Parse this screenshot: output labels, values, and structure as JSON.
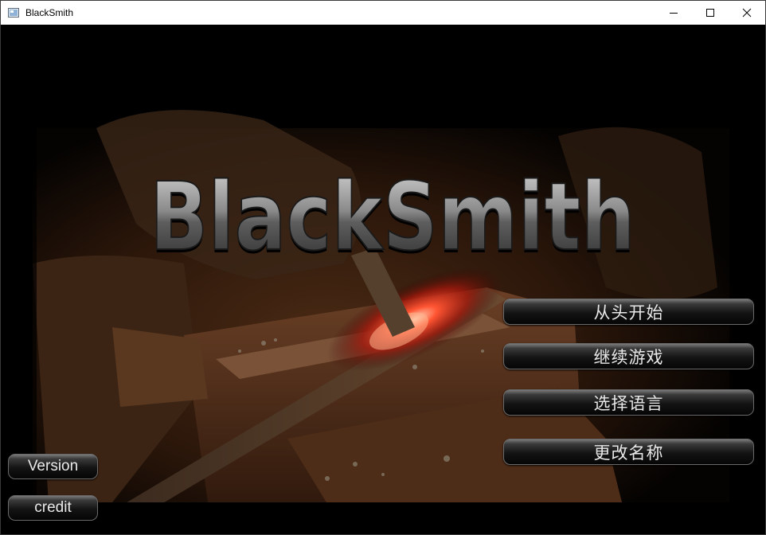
{
  "window": {
    "title": "BlackSmith"
  },
  "logo": {
    "text": "BlackSmith"
  },
  "menu": {
    "new_game": "从头开始",
    "continue_game": "继续游戏",
    "select_language": "选择语言",
    "change_name": "更改名称"
  },
  "side": {
    "version": "Version",
    "credit": "credit"
  }
}
